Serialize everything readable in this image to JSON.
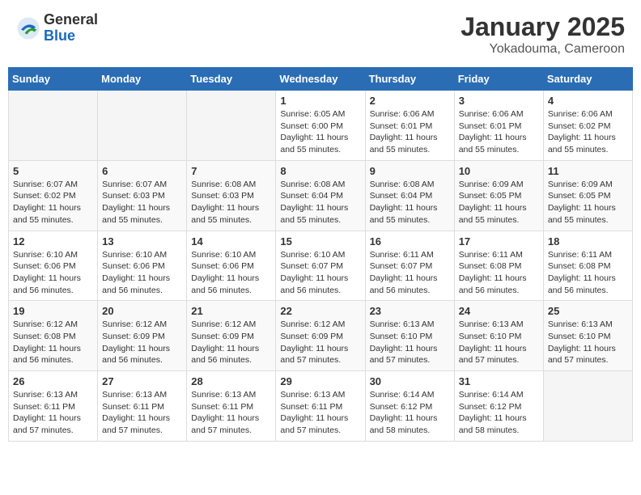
{
  "header": {
    "logo_general": "General",
    "logo_blue": "Blue",
    "title": "January 2025",
    "subtitle": "Yokadouma, Cameroon"
  },
  "days_of_week": [
    "Sunday",
    "Monday",
    "Tuesday",
    "Wednesday",
    "Thursday",
    "Friday",
    "Saturday"
  ],
  "weeks": [
    [
      {
        "day": "",
        "info": ""
      },
      {
        "day": "",
        "info": ""
      },
      {
        "day": "",
        "info": ""
      },
      {
        "day": "1",
        "info": "Sunrise: 6:05 AM\nSunset: 6:00 PM\nDaylight: 11 hours and 55 minutes."
      },
      {
        "day": "2",
        "info": "Sunrise: 6:06 AM\nSunset: 6:01 PM\nDaylight: 11 hours and 55 minutes."
      },
      {
        "day": "3",
        "info": "Sunrise: 6:06 AM\nSunset: 6:01 PM\nDaylight: 11 hours and 55 minutes."
      },
      {
        "day": "4",
        "info": "Sunrise: 6:06 AM\nSunset: 6:02 PM\nDaylight: 11 hours and 55 minutes."
      }
    ],
    [
      {
        "day": "5",
        "info": "Sunrise: 6:07 AM\nSunset: 6:02 PM\nDaylight: 11 hours and 55 minutes."
      },
      {
        "day": "6",
        "info": "Sunrise: 6:07 AM\nSunset: 6:03 PM\nDaylight: 11 hours and 55 minutes."
      },
      {
        "day": "7",
        "info": "Sunrise: 6:08 AM\nSunset: 6:03 PM\nDaylight: 11 hours and 55 minutes."
      },
      {
        "day": "8",
        "info": "Sunrise: 6:08 AM\nSunset: 6:04 PM\nDaylight: 11 hours and 55 minutes."
      },
      {
        "day": "9",
        "info": "Sunrise: 6:08 AM\nSunset: 6:04 PM\nDaylight: 11 hours and 55 minutes."
      },
      {
        "day": "10",
        "info": "Sunrise: 6:09 AM\nSunset: 6:05 PM\nDaylight: 11 hours and 55 minutes."
      },
      {
        "day": "11",
        "info": "Sunrise: 6:09 AM\nSunset: 6:05 PM\nDaylight: 11 hours and 55 minutes."
      }
    ],
    [
      {
        "day": "12",
        "info": "Sunrise: 6:10 AM\nSunset: 6:06 PM\nDaylight: 11 hours and 56 minutes."
      },
      {
        "day": "13",
        "info": "Sunrise: 6:10 AM\nSunset: 6:06 PM\nDaylight: 11 hours and 56 minutes."
      },
      {
        "day": "14",
        "info": "Sunrise: 6:10 AM\nSunset: 6:06 PM\nDaylight: 11 hours and 56 minutes."
      },
      {
        "day": "15",
        "info": "Sunrise: 6:10 AM\nSunset: 6:07 PM\nDaylight: 11 hours and 56 minutes."
      },
      {
        "day": "16",
        "info": "Sunrise: 6:11 AM\nSunset: 6:07 PM\nDaylight: 11 hours and 56 minutes."
      },
      {
        "day": "17",
        "info": "Sunrise: 6:11 AM\nSunset: 6:08 PM\nDaylight: 11 hours and 56 minutes."
      },
      {
        "day": "18",
        "info": "Sunrise: 6:11 AM\nSunset: 6:08 PM\nDaylight: 11 hours and 56 minutes."
      }
    ],
    [
      {
        "day": "19",
        "info": "Sunrise: 6:12 AM\nSunset: 6:08 PM\nDaylight: 11 hours and 56 minutes."
      },
      {
        "day": "20",
        "info": "Sunrise: 6:12 AM\nSunset: 6:09 PM\nDaylight: 11 hours and 56 minutes."
      },
      {
        "day": "21",
        "info": "Sunrise: 6:12 AM\nSunset: 6:09 PM\nDaylight: 11 hours and 56 minutes."
      },
      {
        "day": "22",
        "info": "Sunrise: 6:12 AM\nSunset: 6:09 PM\nDaylight: 11 hours and 57 minutes."
      },
      {
        "day": "23",
        "info": "Sunrise: 6:13 AM\nSunset: 6:10 PM\nDaylight: 11 hours and 57 minutes."
      },
      {
        "day": "24",
        "info": "Sunrise: 6:13 AM\nSunset: 6:10 PM\nDaylight: 11 hours and 57 minutes."
      },
      {
        "day": "25",
        "info": "Sunrise: 6:13 AM\nSunset: 6:10 PM\nDaylight: 11 hours and 57 minutes."
      }
    ],
    [
      {
        "day": "26",
        "info": "Sunrise: 6:13 AM\nSunset: 6:11 PM\nDaylight: 11 hours and 57 minutes."
      },
      {
        "day": "27",
        "info": "Sunrise: 6:13 AM\nSunset: 6:11 PM\nDaylight: 11 hours and 57 minutes."
      },
      {
        "day": "28",
        "info": "Sunrise: 6:13 AM\nSunset: 6:11 PM\nDaylight: 11 hours and 57 minutes."
      },
      {
        "day": "29",
        "info": "Sunrise: 6:13 AM\nSunset: 6:11 PM\nDaylight: 11 hours and 57 minutes."
      },
      {
        "day": "30",
        "info": "Sunrise: 6:14 AM\nSunset: 6:12 PM\nDaylight: 11 hours and 58 minutes."
      },
      {
        "day": "31",
        "info": "Sunrise: 6:14 AM\nSunset: 6:12 PM\nDaylight: 11 hours and 58 minutes."
      },
      {
        "day": "",
        "info": ""
      }
    ]
  ]
}
